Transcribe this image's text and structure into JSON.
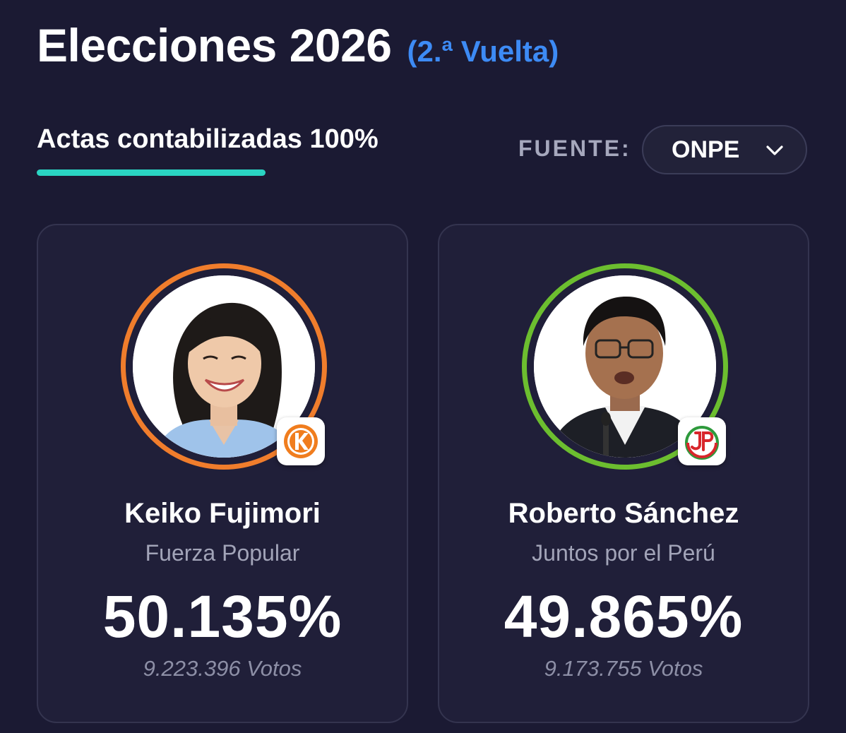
{
  "header": {
    "title": "Elecciones 2026",
    "round": "(2.ª Vuelta)"
  },
  "tabs": {
    "active_label": "Actas contabilizadas 100%",
    "progress_percent": 100
  },
  "source": {
    "label": "FUENTE:",
    "value": "ONPE",
    "icon": "chevron-down-icon"
  },
  "candidates": [
    {
      "name": "Keiko Fujimori",
      "party": "Fuerza Popular",
      "percent": "50.135%",
      "votes": "9.223.396 Votos",
      "ring_color": "#f07d2c",
      "party_logo": "fuerza-popular-logo",
      "party_logo_text": "K"
    },
    {
      "name": "Roberto Sánchez",
      "party": "Juntos por el Perú",
      "percent": "49.865%",
      "votes": "9.173.755 Votos",
      "ring_color": "#6cbe2f",
      "party_logo": "juntos-por-el-peru-logo",
      "party_logo_text": "JP"
    }
  ],
  "colors": {
    "background": "#1b1a33",
    "card": "#201f39",
    "accent_blue": "#3d8bf5",
    "underline": "#2ad4c3"
  }
}
